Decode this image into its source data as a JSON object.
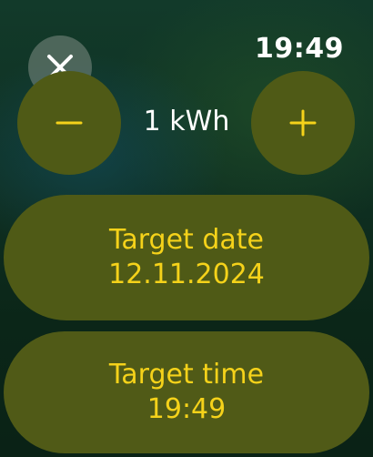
{
  "status": {
    "time": "19:49"
  },
  "close": {
    "icon": "close-icon"
  },
  "stepper": {
    "value": "1 kWh",
    "minus_icon": "minus-icon",
    "plus_icon": "plus-icon"
  },
  "target_date": {
    "label": "Target date",
    "value": "12.11.2024"
  },
  "target_time": {
    "label": "Target time",
    "value": "19:49"
  },
  "colors": {
    "accent": "#f5d21a",
    "button_bg": "#4f5a16",
    "background": "#0f3022"
  }
}
